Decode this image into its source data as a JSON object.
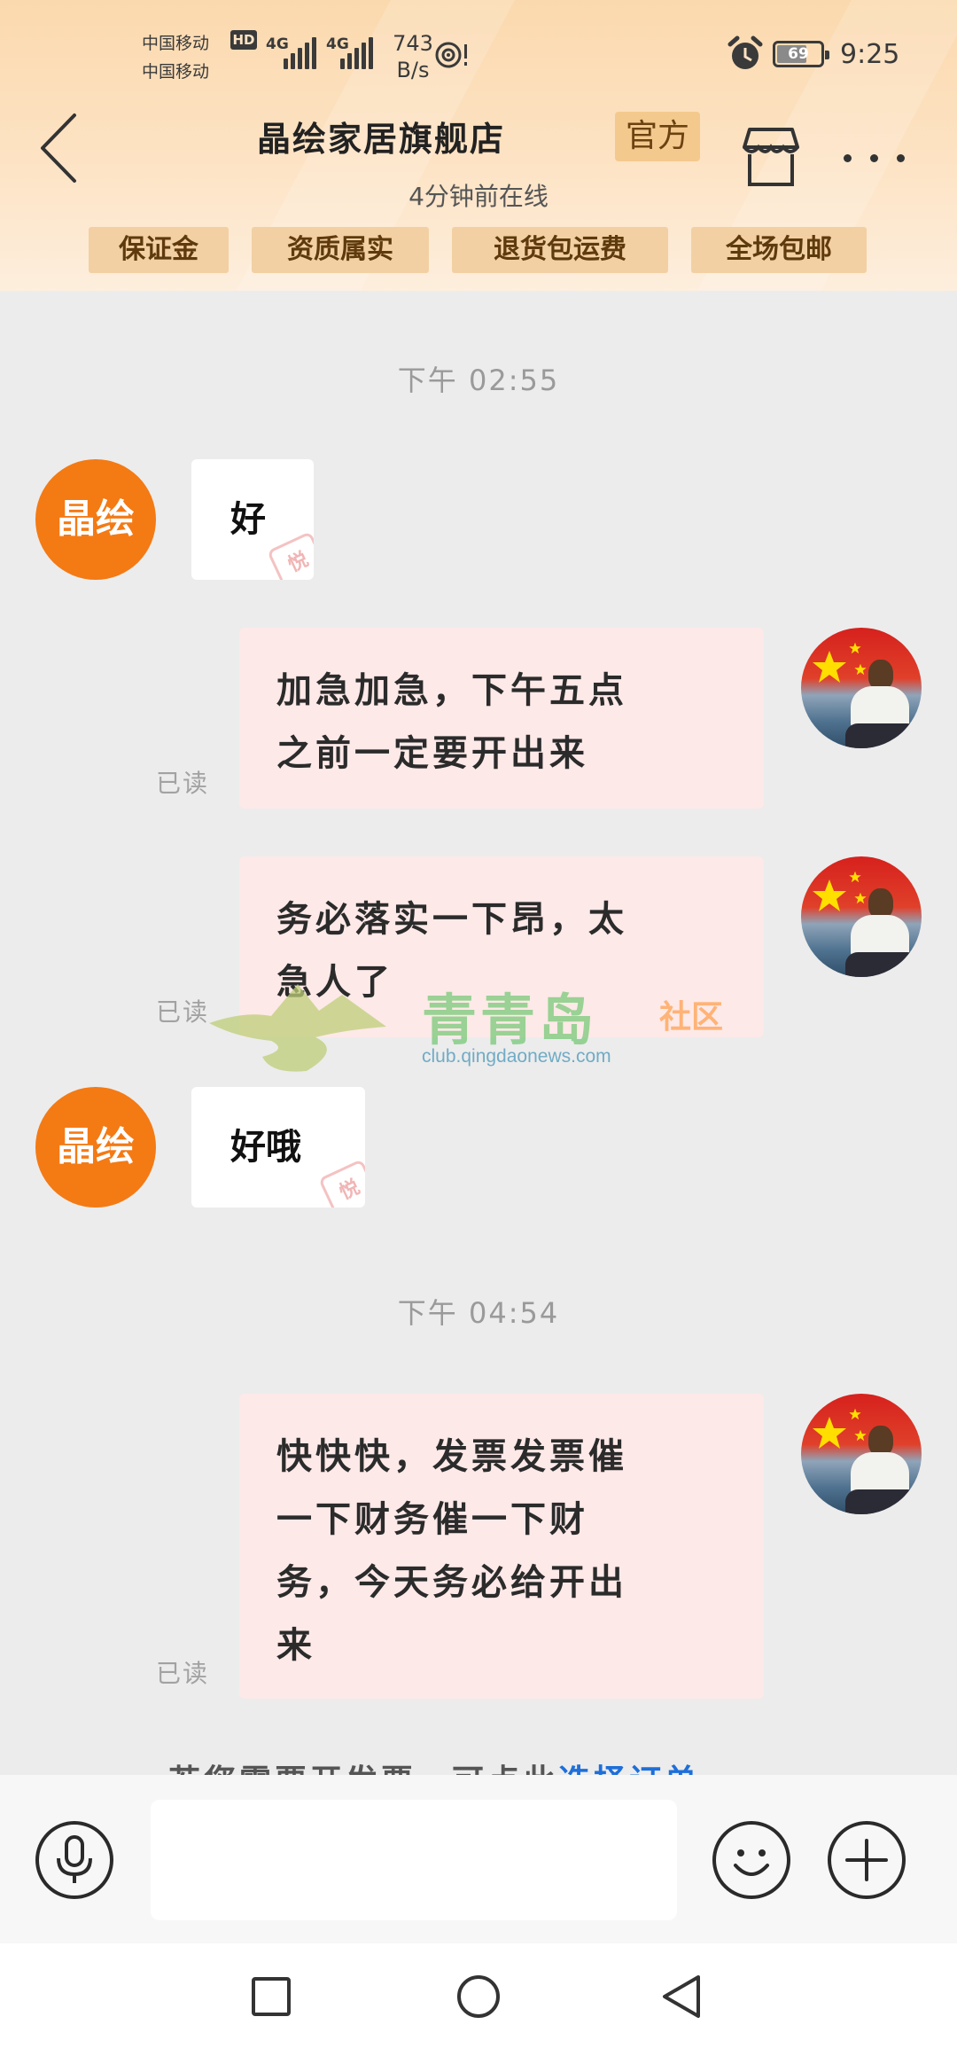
{
  "status_bar": {
    "carrier_1": "中国移动",
    "carrier_2": "中国移动",
    "hd": "HD",
    "net_1": "4G",
    "net_2": "4G",
    "speed_value": "743",
    "speed_unit": "B/s",
    "battery": "69",
    "battery_level": 0.69,
    "time": "9:25"
  },
  "header": {
    "shop_name": "晶绘家居旗舰店",
    "official_badge": "官方",
    "online_status": "4分钟前在线",
    "tags": [
      "保证金",
      "资质属实",
      "退货包运费",
      "全场包邮"
    ]
  },
  "chat": {
    "time_1": "下午 02:55",
    "time_2": "下午 04:54",
    "shop_avatar_text": "晶绘",
    "messages": [
      {
        "from": "shop",
        "text": "好"
      },
      {
        "from": "me",
        "lines": [
          "加急加急，下午五点",
          "之前一定要开出来"
        ],
        "read": "已读"
      },
      {
        "from": "me",
        "lines": [
          "务必落实一下昂，太",
          "急人了"
        ],
        "read": "已读"
      },
      {
        "from": "shop",
        "text": "好哦"
      },
      {
        "from": "me",
        "lines": [
          "快快快，发票发票催",
          "一下财务催一下财",
          "务，今天务必给开出",
          "来"
        ],
        "read": "已读"
      }
    ],
    "invoice_hint_prefix": "若您需要开发票，可点此",
    "invoice_hint_link": "选择订单"
  },
  "watermark": {
    "name": "青青岛",
    "sub": "社区",
    "url": "club.qingdaonews.com"
  },
  "colors": {
    "shop_avatar": "#f47a14",
    "out_bubble": "#fde9e8",
    "link": "#1e6fd9"
  },
  "icons": [
    "back-arrow-icon",
    "store-icon",
    "more-icon",
    "microphone-icon",
    "emoji-icon",
    "plus-icon",
    "square-icon",
    "circle-icon",
    "triangle-back-icon"
  ]
}
